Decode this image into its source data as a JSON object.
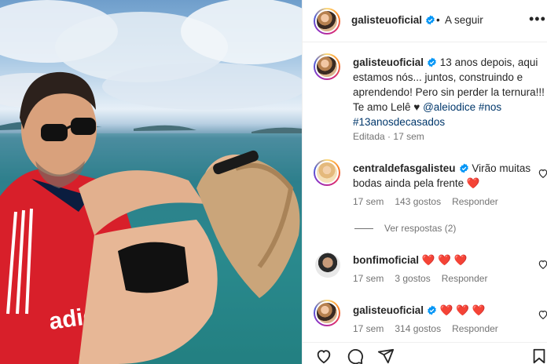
{
  "post": {
    "author": "galisteuoficial",
    "follow_label": "A seguir",
    "separator": "•",
    "caption_line1": "13 anos depois, aqui estamos nós... juntos, construindo e aprendendo! Pero sin perder la ternura!!! Te amo Lelê ♥",
    "mention": "@aleiodice",
    "hashtag1": "#nos",
    "hashtag2": "#13anosdecasados",
    "edited_label": "Editada",
    "edited_time": "17 sem",
    "meta_dot": "·"
  },
  "comments": [
    {
      "user": "centraldefasgalisteu",
      "text": "Virão muitas bodas ainda pela frente",
      "emoji": "❤️",
      "time": "17 sem",
      "likes": "143 gostos",
      "reply": "Responder",
      "view_replies": "Ver respostas (2)"
    },
    {
      "user": "bonfimoficial",
      "emoji": "❤️ ❤️ ❤️",
      "time": "17 sem",
      "likes": "3 gostos",
      "reply": "Responder"
    },
    {
      "user": "galisteuoficial",
      "emoji": "❤️ ❤️ ❤️",
      "time": "17 sem",
      "likes": "314 gostos",
      "reply": "Responder"
    }
  ],
  "icons": {
    "more": "more-options-icon",
    "verified": "verified-badge-icon",
    "like": "heart-outline-icon",
    "comment": "comment-icon",
    "share": "share-icon",
    "save": "bookmark-icon"
  },
  "colors": {
    "verified_blue": "#0095f6",
    "heart_red": "#ed4956",
    "link_blue": "#00376b",
    "muted_gray": "#737373"
  }
}
